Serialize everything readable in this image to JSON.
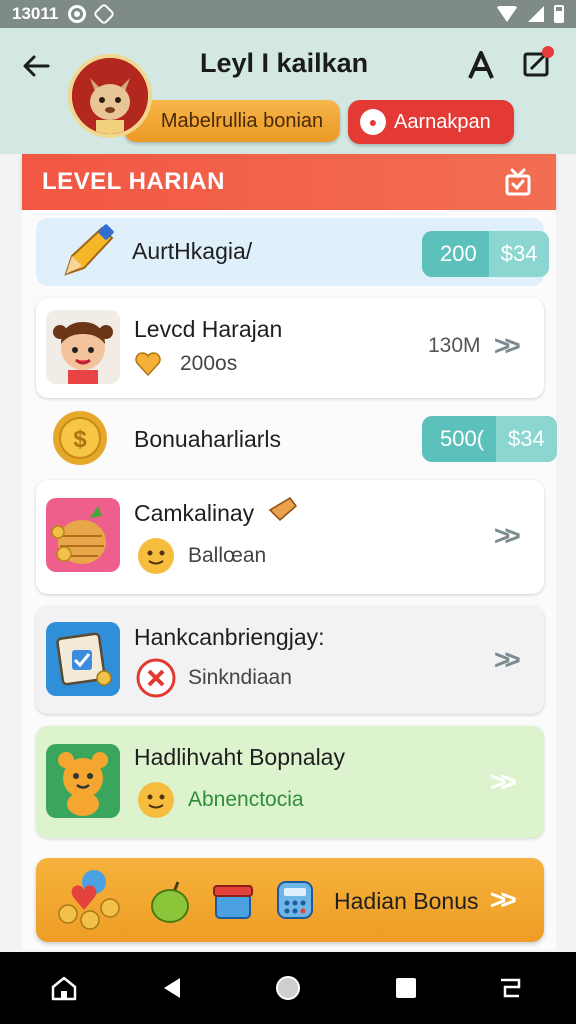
{
  "status_bar": {
    "time": "13011"
  },
  "header": {
    "title": "Leyl I kailkan",
    "pill_a": "Mabelrullia bonian",
    "pill_b": "Aarnakpan"
  },
  "section": {
    "title": "LEVEL HARIAN"
  },
  "rows": [
    {
      "title": "AurtHkagia/",
      "tag_a": "200",
      "tag_b": "$34"
    },
    {
      "title": "Levcd Harajan",
      "sub": "200os",
      "value": "130M"
    },
    {
      "title": "Bonuaharliarls",
      "tag_a": "500(",
      "tag_b": "$34"
    },
    {
      "title": "Camkalinay",
      "sub": "Ballœan"
    },
    {
      "title": "Hankcanbriengjay:",
      "sub": "Sinkndiaan"
    },
    {
      "title": "Hadlihvaht Bopnalay",
      "sub": "Abnenctocia"
    },
    {
      "title": "Hadian Bonus"
    }
  ],
  "colors": {
    "accent_red": "#f25744",
    "teal": "#5cc1bb",
    "orange": "#f5b23c",
    "green_row": "#dcf3cd"
  }
}
